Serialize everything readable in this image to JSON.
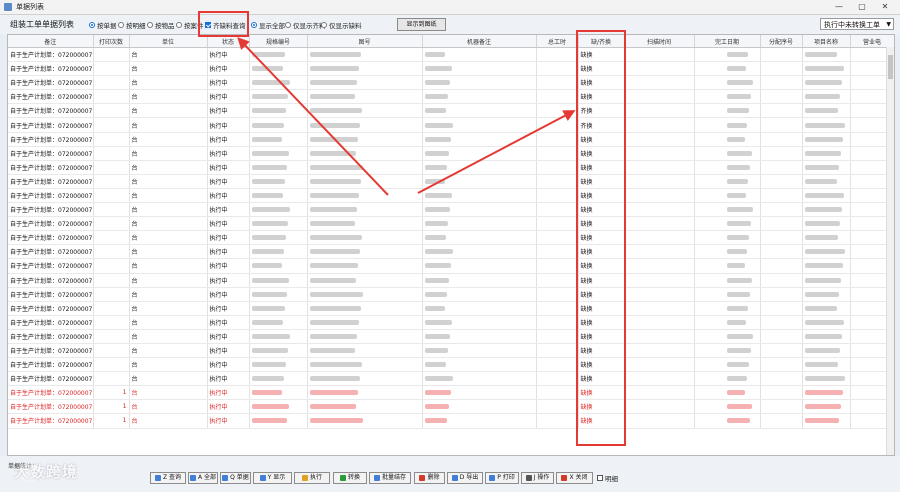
{
  "window": {
    "title": "单据列表",
    "controls": [
      "—",
      "▢",
      "✕"
    ]
  },
  "toolbar": {
    "heading": "组装工单单据列表",
    "options": [
      {
        "label": "按单据",
        "kind": "radio",
        "checked": true
      },
      {
        "label": "按明细",
        "kind": "radio",
        "checked": false
      },
      {
        "label": "按物品",
        "kind": "radio",
        "checked": false
      },
      {
        "label": "按案件",
        "kind": "radio",
        "checked": false
      },
      {
        "label": "齐缺料查询",
        "kind": "checkbox",
        "checked": true
      },
      {
        "label": "显示全部",
        "kind": "radio",
        "checked": true
      },
      {
        "label": "仅显示齐料",
        "kind": "radio",
        "checked": false
      },
      {
        "label": "仅显示缺料",
        "kind": "radio",
        "checked": false
      }
    ],
    "show_button": "显示到图纸",
    "status_select": "执行中未转换工单"
  },
  "table": {
    "columns": [
      "备注",
      "打印次数",
      "单位",
      "状态",
      "规格编号",
      "图号",
      "机器备注",
      "总工时",
      "缺/齐换",
      "扫描时间",
      "完工日期",
      "分配序号",
      "项目名称",
      "营业电"
    ],
    "rows": [
      {
        "note": "自于生产计划单：0720000071",
        "unit": "台",
        "status": "执行中",
        "lack": "缺换",
        "print": "",
        "red": false
      },
      {
        "note": "自于生产计划单：0720000071",
        "unit": "台",
        "status": "执行中",
        "lack": "缺换",
        "print": "",
        "red": false
      },
      {
        "note": "自于生产计划单：0720000071",
        "unit": "台",
        "status": "执行中",
        "lack": "缺换",
        "print": "",
        "red": false
      },
      {
        "note": "自于生产计划单：0720000071",
        "unit": "台",
        "status": "执行中",
        "lack": "缺换",
        "print": "",
        "red": false
      },
      {
        "note": "自于生产计划单：0720000071",
        "unit": "台",
        "status": "执行中",
        "lack": "齐换",
        "print": "",
        "red": false
      },
      {
        "note": "自于生产计划单：0720000071",
        "unit": "台",
        "status": "执行中",
        "lack": "齐换",
        "print": "",
        "red": false
      },
      {
        "note": "自于生产计划单：0720000071",
        "unit": "台",
        "status": "执行中",
        "lack": "缺换",
        "print": "",
        "red": false
      },
      {
        "note": "自于生产计划单：0720000071",
        "unit": "台",
        "status": "执行中",
        "lack": "缺换",
        "print": "",
        "red": false
      },
      {
        "note": "自于生产计划单：0720000071",
        "unit": "台",
        "status": "执行中",
        "lack": "缺换",
        "print": "",
        "red": false
      },
      {
        "note": "自于生产计划单：0720000071",
        "unit": "台",
        "status": "执行中",
        "lack": "缺换",
        "print": "",
        "red": false
      },
      {
        "note": "自于生产计划单：0720000071",
        "unit": "台",
        "status": "执行中",
        "lack": "缺换",
        "print": "",
        "red": false
      },
      {
        "note": "自于生产计划单：0720000071",
        "unit": "台",
        "status": "执行中",
        "lack": "缺换",
        "print": "",
        "red": false
      },
      {
        "note": "自于生产计划单：0720000071",
        "unit": "台",
        "status": "执行中",
        "lack": "缺换",
        "print": "",
        "red": false
      },
      {
        "note": "自于生产计划单：0720000071",
        "unit": "台",
        "status": "执行中",
        "lack": "缺换",
        "print": "",
        "red": false
      },
      {
        "note": "自于生产计划单：0720000071",
        "unit": "台",
        "status": "执行中",
        "lack": "缺换",
        "print": "",
        "red": false
      },
      {
        "note": "自于生产计划单：0720000071",
        "unit": "台",
        "status": "执行中",
        "lack": "缺换",
        "print": "",
        "red": false
      },
      {
        "note": "自于生产计划单：0720000071",
        "unit": "台",
        "status": "执行中",
        "lack": "缺换",
        "print": "",
        "red": false
      },
      {
        "note": "自于生产计划单：0720000071",
        "unit": "台",
        "status": "执行中",
        "lack": "缺换",
        "print": "",
        "red": false
      },
      {
        "note": "自于生产计划单：0720000071",
        "unit": "台",
        "status": "执行中",
        "lack": "缺换",
        "print": "",
        "red": false
      },
      {
        "note": "自于生产计划单：0720000071",
        "unit": "台",
        "status": "执行中",
        "lack": "缺换",
        "print": "",
        "red": false
      },
      {
        "note": "自于生产计划单：0720000071",
        "unit": "台",
        "status": "执行中",
        "lack": "缺换",
        "print": "",
        "red": false
      },
      {
        "note": "自于生产计划单：0720000071",
        "unit": "台",
        "status": "执行中",
        "lack": "缺换",
        "print": "",
        "red": false
      },
      {
        "note": "自于生产计划单：0720000071",
        "unit": "台",
        "status": "执行中",
        "lack": "缺换",
        "print": "",
        "red": false
      },
      {
        "note": "自于生产计划单：0720000071",
        "unit": "台",
        "status": "执行中",
        "lack": "缺换",
        "print": "",
        "red": false
      },
      {
        "note": "自于生产计划单：0720000071",
        "unit": "台",
        "status": "执行中",
        "lack": "缺换",
        "print": "1",
        "red": true
      },
      {
        "note": "自于生产计划单：0720000071",
        "unit": "台",
        "status": "执行中",
        "lack": "缺换",
        "print": "1",
        "red": true
      },
      {
        "note": "自于生产计划单：0720000071",
        "unit": "台",
        "status": "执行中",
        "lack": "缺换",
        "print": "1",
        "red": true
      }
    ]
  },
  "footer": {
    "status_text": "单据统计：",
    "buttons": [
      {
        "label": "Z 查询",
        "color": "#3f7fd8"
      },
      {
        "label": "A 全部",
        "color": "#3f7fd8"
      },
      {
        "label": "Q 单据",
        "color": "#3f7fd8"
      },
      {
        "label": "Y 显示",
        "color": "#3f7fd8"
      },
      {
        "label": "执行",
        "color": "#e0a020"
      },
      {
        "label": "转换",
        "color": "#2a9a3a"
      },
      {
        "label": "批量结存",
        "color": "#3f7fd8"
      },
      {
        "label": "删除",
        "color": "#d33a2a"
      },
      {
        "label": "D 导出",
        "color": "#3f7fd8"
      },
      {
        "label": "P 打印",
        "color": "#3f7fd8"
      },
      {
        "label": "J 操作",
        "color": "#555555"
      },
      {
        "label": "X 关闭",
        "color": "#d33a2a"
      }
    ],
    "detail_checkbox": "明细"
  },
  "watermark": "大数跨境",
  "colors": {
    "highlight": "#e53935",
    "accent": "#1a6fd6",
    "row_red": "#dd2222"
  }
}
